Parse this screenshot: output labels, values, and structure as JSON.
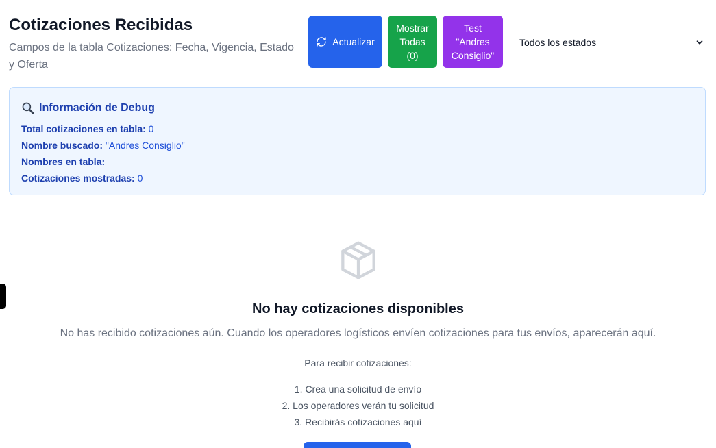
{
  "header": {
    "title": "Cotizaciones Recibidas",
    "subtitle": "Campos de la tabla Cotizaciones: Fecha, Vigencia, Estado y Oferta"
  },
  "actions": {
    "refresh_label": "Actualizar",
    "show_all_line1": "Mostrar",
    "show_all_line2": "Todas",
    "show_all_count": "(0)",
    "test_line1": "Test",
    "test_line2": "\"Andres",
    "test_line3": "Consiglio\""
  },
  "filter": {
    "selected": "Todos los estados"
  },
  "debug": {
    "title": "Información de Debug",
    "rows": [
      {
        "label": "Total cotizaciones en tabla:",
        "value": "0"
      },
      {
        "label": "Nombre buscado:",
        "value": "\"Andres Consiglio\""
      },
      {
        "label": "Nombres en tabla:",
        "value": ""
      },
      {
        "label": "Cotizaciones mostradas:",
        "value": "0"
      }
    ]
  },
  "empty_state": {
    "title": "No hay cotizaciones disponibles",
    "description": "No has recibido cotizaciones aún. Cuando los operadores logísticos envíen cotizaciones para tus envíos, aparecerán aquí.",
    "steps_heading": "Para recibir cotizaciones:",
    "steps": [
      "1. Crea una solicitud de envío",
      "2. Los operadores verán tu solicitud",
      "3. Recibirás cotizaciones aquí"
    ]
  },
  "icons": {
    "refresh": "refresh-icon",
    "chevron": "chevron-down-icon",
    "debug": "magnifier-icon",
    "empty": "package-icon"
  },
  "colors": {
    "primary": "#2563eb",
    "success": "#16a34a",
    "purple": "#9333ea",
    "debug_bg": "#eff6ff",
    "debug_text": "#1e40af"
  }
}
